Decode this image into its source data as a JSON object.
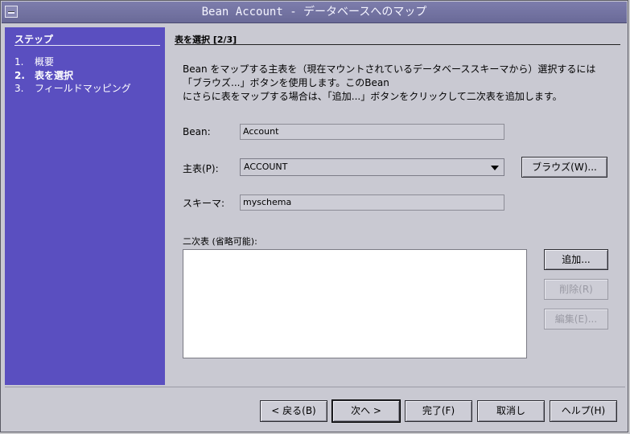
{
  "window": {
    "title": "Bean Account - データベースへのマップ"
  },
  "sidebar": {
    "heading": "ステップ",
    "steps": [
      {
        "num": "1.",
        "label": "概要",
        "active": false
      },
      {
        "num": "2.",
        "label": "表を選択",
        "active": true
      },
      {
        "num": "3.",
        "label": "フィールドマッピング",
        "active": false
      }
    ]
  },
  "main": {
    "section_title": "表を選択 [2/3]",
    "description": [
      "Bean をマップする主表を（現在マウントされているデータベーススキーマから）選択するには",
      "「ブラウズ...」ボタンを使用します。このBean",
      "にさらに表をマップする場合は、「追加...」ボタンをクリックして二次表を追加します。"
    ],
    "bean_label": "Bean:",
    "bean_value": "Account",
    "primary_label": "主表(P):",
    "primary_value": "ACCOUNT",
    "browse_button": "ブラウズ(W)...",
    "schema_label": "スキーマ:",
    "schema_value": "myschema",
    "secondary_label": "二次表 (省略可能):",
    "secondary_tables": [],
    "add_button": "追加...",
    "remove_button": "削除(R)",
    "edit_button": "編集(E)..."
  },
  "footer": {
    "back_button": "< 戻る(B)",
    "next_button": "次へ >",
    "finish_button": "完了(F)",
    "cancel_button": "取消し",
    "help_button": "ヘルプ(H)"
  }
}
